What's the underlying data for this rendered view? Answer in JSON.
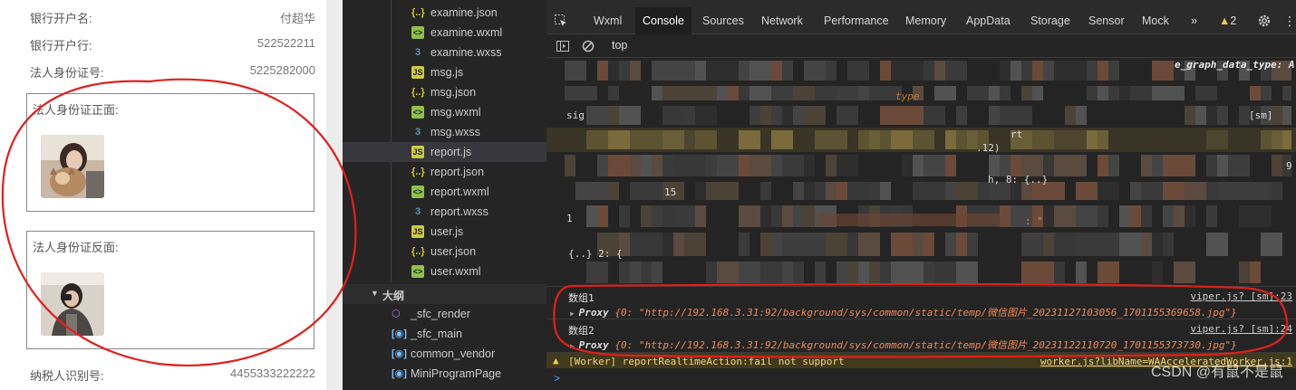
{
  "form": {
    "rows": [
      {
        "label": "银行开户名:",
        "value": "付超华"
      },
      {
        "label": "银行开户行:",
        "value": "522522211"
      },
      {
        "label": "法人身份证号:",
        "value": "5225282000"
      }
    ],
    "id_front_title": "法人身份证正面:",
    "id_back_title": "法人身份证反面:",
    "tax_label": "纳税人识别号:",
    "tax_value": "4455333222222"
  },
  "file_tree": {
    "files": [
      {
        "name": "examine.json",
        "type": "json",
        "icon": "{..}"
      },
      {
        "name": "examine.wxml",
        "type": "wxml",
        "icon": "<>"
      },
      {
        "name": "examine.wxss",
        "type": "wxss",
        "icon": "3"
      },
      {
        "name": "msg.js",
        "type": "js",
        "icon": "JS"
      },
      {
        "name": "msg.json",
        "type": "json",
        "icon": "{..}"
      },
      {
        "name": "msg.wxml",
        "type": "wxml",
        "icon": "<>"
      },
      {
        "name": "msg.wxss",
        "type": "wxss",
        "icon": "3"
      },
      {
        "name": "report.js",
        "type": "js",
        "icon": "JS",
        "selected": true
      },
      {
        "name": "report.json",
        "type": "json",
        "icon": "{..}"
      },
      {
        "name": "report.wxml",
        "type": "wxml",
        "icon": "<>"
      },
      {
        "name": "report.wxss",
        "type": "wxss",
        "icon": "3"
      },
      {
        "name": "user.js",
        "type": "js",
        "icon": "JS"
      },
      {
        "name": "user.json",
        "type": "json",
        "icon": "{..}"
      },
      {
        "name": "user.wxml",
        "type": "wxml",
        "icon": "<>"
      }
    ],
    "outline_title": "大纲",
    "outline_items": [
      {
        "name": "_sfc_render",
        "icon": "cube-icon"
      },
      {
        "name": "_sfc_main",
        "icon": "variable-icon"
      },
      {
        "name": "common_vendor",
        "icon": "variable-icon"
      },
      {
        "name": "MiniProgramPage",
        "icon": "variable-icon"
      }
    ]
  },
  "devtools": {
    "tabs": [
      "Wxml",
      "Console",
      "Sources",
      "Network",
      "Performance",
      "Memory",
      "AppData",
      "Storage",
      "Sensor",
      "Mock"
    ],
    "active_tab": "Console",
    "more_tabs": "»",
    "warning_count": "2",
    "context": "top",
    "obscured_fragments": {
      "f1": "e_graph_data_type: A",
      "f2": "type",
      "f3": "sig",
      "f4": "[sm]",
      "f5": "rt",
      "f6": ".12)",
      "f7": "9",
      "f8": "h, 8: {..}",
      "f9": "15",
      "f10": ": \"",
      "f11": "1",
      "f12": "{..} 2: {"
    },
    "messages": [
      {
        "label": "数组1",
        "source": "viper.js? [sm]:23",
        "proxy": "Proxy",
        "content": "{0: \"http://192.168.3.31:92/background/sys/common/static/temp/微信图片_20231127103056_1701155369658.jpg\"}"
      },
      {
        "label": "数组2",
        "source": "viper.js? [sm]:24",
        "proxy": "Proxy",
        "content": "{0: \"http://192.168.3.31:92/background/sys/common/static/temp/微信图片_20231122110720_1701155373730.jpg\"}"
      }
    ],
    "warning": {
      "text": "[Worker] reportRealtimeAction:fail not support",
      "source": "worker.js?libName=WAAcceleratedWorker.js:1"
    },
    "prompt": ">"
  },
  "watermark": "CSDN @有鼠不是鼠",
  "colors": {
    "annotation_red": "#e0201b",
    "devtools_bg": "#242424",
    "tree_bg": "#252526",
    "string_orange": "#f28b54"
  }
}
